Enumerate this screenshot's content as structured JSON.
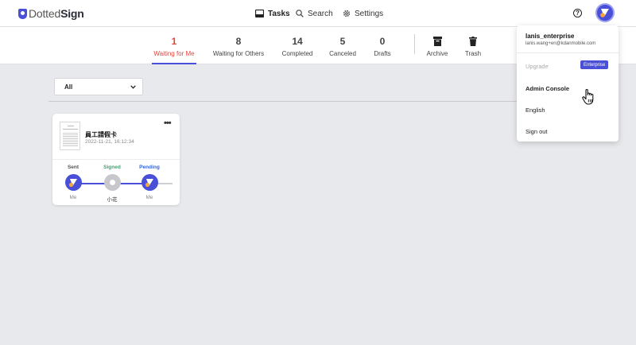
{
  "app": {
    "logo_main": "Dotted",
    "logo_suffix": "Sign",
    "brand_color": "#4a4fd8"
  },
  "nav": {
    "tasks": "Tasks",
    "search": "Search",
    "settings": "Settings",
    "help": "?"
  },
  "tabs": [
    {
      "count": "1",
      "label": "Waiting for Me",
      "active": true
    },
    {
      "count": "8",
      "label": "Waiting for Others"
    },
    {
      "count": "14",
      "label": "Completed"
    },
    {
      "count": "5",
      "label": "Canceled"
    },
    {
      "count": "0",
      "label": "Drafts"
    },
    {
      "label": "Archive",
      "icon": "archive-icon"
    },
    {
      "label": "Trash",
      "icon": "trash-icon"
    }
  ],
  "filter": {
    "selected": "All"
  },
  "card": {
    "title": "員工請假卡",
    "timestamp": "2022-11-21, 16:12:34",
    "more": "•••",
    "steps": [
      {
        "status": "Sent",
        "who": "Me",
        "color": "#555555"
      },
      {
        "status": "Signed",
        "who": "小花",
        "color": "#36a86c"
      },
      {
        "status": "Pending",
        "who": "Me",
        "color": "#2e63d8"
      }
    ]
  },
  "menu": {
    "username": "lanis_enterprise",
    "email": "lanis.wang+en@kdanmobile.com",
    "upgrade": "Upgrade",
    "plan_badge": "Enterprise",
    "admin_console": "Admin Console",
    "language": "English",
    "sign_out": "Sign out"
  }
}
